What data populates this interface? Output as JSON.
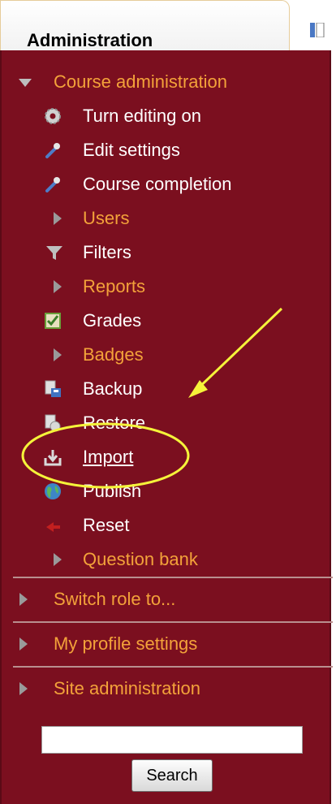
{
  "header": {
    "title": "Administration"
  },
  "course_admin": {
    "label": "Course administration",
    "items": {
      "turn_editing_on": "Turn editing on",
      "edit_settings": "Edit settings",
      "course_completion": "Course completion",
      "users": "Users",
      "filters": "Filters",
      "reports": "Reports",
      "grades": "Grades",
      "badges": "Badges",
      "backup": "Backup",
      "restore": "Restore",
      "import": "Import",
      "publish": "Publish",
      "reset": "Reset",
      "question_bank": "Question bank"
    }
  },
  "sections": {
    "switch_role": "Switch role to...",
    "my_profile": "My profile settings",
    "site_admin": "Site administration"
  },
  "search": {
    "button": "Search",
    "value": ""
  },
  "colors": {
    "panel_bg": "#7b0f1f",
    "link_orange": "#f3a23a",
    "annotation_yellow": "#f5f33a"
  },
  "icons": {
    "dock": "dock-icon",
    "turn_editing_on": "gear-icon",
    "edit_settings": "wrench-icon",
    "course_completion": "wrench-icon",
    "filters": "funnel-icon",
    "grades": "grades-icon",
    "backup": "backup-icon",
    "restore": "restore-icon",
    "import": "import-icon",
    "publish": "globe-icon",
    "reset": "reset-icon"
  }
}
